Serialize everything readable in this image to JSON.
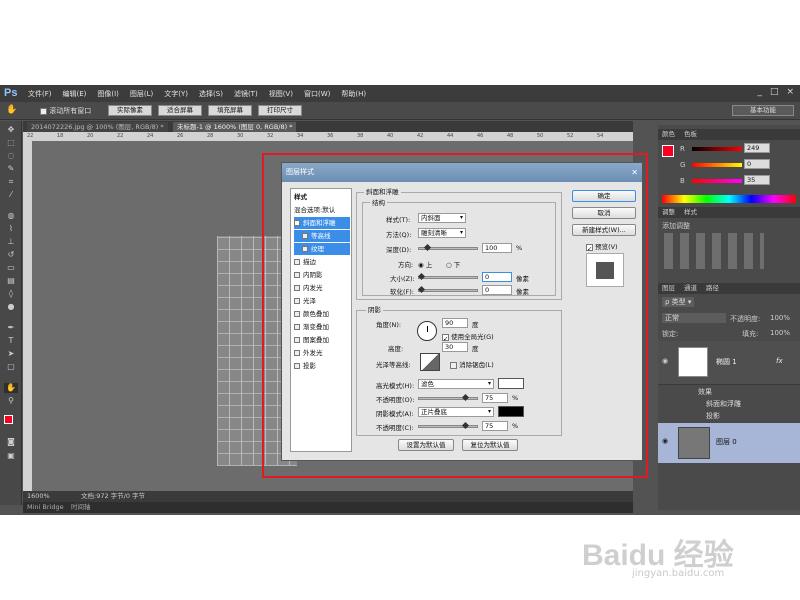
{
  "app": {
    "logo": "Ps",
    "menus": [
      "文件(F)",
      "编辑(E)",
      "图像(I)",
      "图层(L)",
      "文字(Y)",
      "选择(S)",
      "滤镜(T)",
      "视图(V)",
      "窗口(W)",
      "帮助(H)"
    ],
    "winctl": [
      "_",
      "□",
      "×"
    ]
  },
  "options": {
    "scroll_all": "滚动所有窗口",
    "btn_actual": "实际像素",
    "btn_fit": "适合屏幕",
    "btn_fill": "填充屏幕",
    "btn_print": "打印尺寸",
    "workspace": "基本功能"
  },
  "tabs": [
    "2014072226.jpg @ 100% (图层, RGB/8) *",
    "未标题-1 @ 1600% (图层 0, RGB/8) *"
  ],
  "ruler": [
    "22",
    "18",
    "20",
    "22",
    "24",
    "26",
    "28",
    "30",
    "32",
    "34",
    "36",
    "38",
    "40",
    "42",
    "44",
    "46",
    "48",
    "50",
    "52",
    "54"
  ],
  "status": {
    "zoom": "1600%",
    "doc": "文档:972 字节/0 字节"
  },
  "bridge": [
    "Mini Bridge",
    "时间轴"
  ],
  "panels": {
    "color_tabs": [
      "颜色",
      "色板"
    ],
    "rgb": {
      "r": "249",
      "g": "0",
      "b": "35"
    },
    "adj_tabs": [
      "调整",
      "样式"
    ],
    "adj_add": "添加调整",
    "layer_tabs": [
      "图层",
      "通道",
      "路径"
    ],
    "layer_kind": "类型",
    "blend_mode": "正常",
    "opacity_label": "不透明度:",
    "opacity": "100%",
    "lock_label": "锁定:",
    "fill_label": "填充:",
    "fill": "100%",
    "layers": [
      {
        "name": "椭圆 1",
        "fx": "fx"
      },
      {
        "name": "效果"
      },
      {
        "name": "斜面和浮雕"
      },
      {
        "name": "投影"
      },
      {
        "name": "图层 0"
      }
    ]
  },
  "dialog": {
    "title": "图层样式",
    "styles_header": "样式",
    "blend_default": "混合选项:默认",
    "items": [
      "斜面和浮雕",
      "等高线",
      "纹理",
      "描边",
      "内阴影",
      "内发光",
      "光泽",
      "颜色叠加",
      "渐变叠加",
      "图案叠加",
      "外发光",
      "投影"
    ],
    "ok": "确定",
    "cancel": "取消",
    "new_style": "新建样式(W)...",
    "preview": "预览(V)",
    "bevel_section": "斜面和浮雕",
    "structure": "结构",
    "style_label": "样式(T):",
    "style_value": "内斜面",
    "method_label": "方法(Q):",
    "method_value": "雕刻清晰",
    "depth_label": "深度(D):",
    "depth": "100",
    "pct": "%",
    "dir_label": "方向:",
    "dir_up": "上",
    "dir_down": "下",
    "size_label": "大小(Z):",
    "size": "0",
    "px": "像素",
    "soften_label": "软化(F):",
    "soften": "0",
    "shading": "阴影",
    "angle_label": "角度(N):",
    "angle": "90",
    "deg": "度",
    "global_light": "使用全局光(G)",
    "altitude_label": "高度:",
    "altitude": "30",
    "gloss_label": "光泽等高线:",
    "antialias": "消除锯齿(L)",
    "hl_mode_label": "高光模式(H):",
    "hl_mode": "滤色",
    "hl_color": "#ffffff",
    "hl_op_label": "不透明度(O):",
    "hl_op": "75",
    "sh_mode_label": "阴影模式(A):",
    "sh_mode": "正片叠底",
    "sh_color": "#000000",
    "sh_op_label": "不透明度(C):",
    "sh_op": "75",
    "set_default": "设置为默认值",
    "reset_default": "复位为默认值"
  },
  "watermark": {
    "brand": "Baidu 经验",
    "url": "jingyan.baidu.com"
  }
}
